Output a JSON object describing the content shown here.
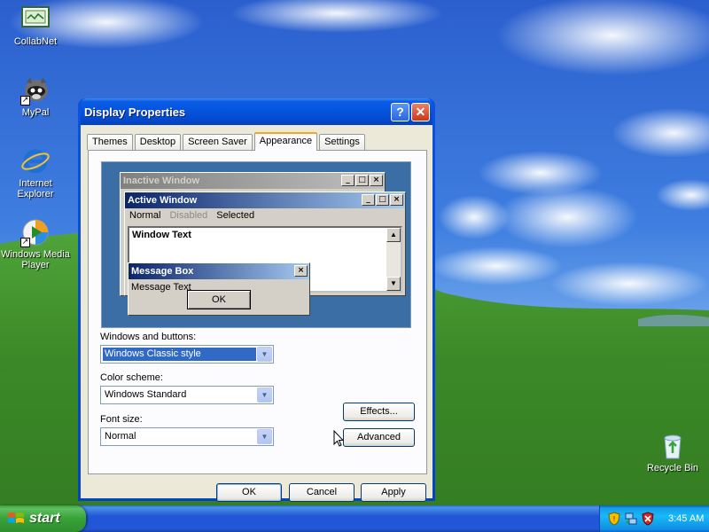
{
  "desktop": {
    "icons": [
      {
        "label": "CollabNet",
        "icon": "collabnet-icon"
      },
      {
        "label": "MyPal",
        "icon": "mypal-icon"
      },
      {
        "label": "Internet Explorer",
        "icon": "internet-explorer-icon"
      },
      {
        "label": "Windows Media Player",
        "icon": "media-player-icon"
      },
      {
        "label": "Recycle Bin",
        "icon": "recycle-bin-icon"
      }
    ]
  },
  "dialog": {
    "title": "Display Properties",
    "help_label": "?",
    "close_label": "✕",
    "tabs": [
      "Themes",
      "Desktop",
      "Screen Saver",
      "Appearance",
      "Settings"
    ],
    "active_tab": "Appearance",
    "preview": {
      "inactive_title": "Inactive Window",
      "active_title": "Active Window",
      "menu": {
        "normal": "Normal",
        "disabled": "Disabled",
        "selected": "Selected"
      },
      "window_text": "Window Text",
      "message_title": "Message Box",
      "message_text": "Message Text",
      "ok_label": "OK"
    },
    "windows_buttons": {
      "label": "Windows and buttons:",
      "value": "Windows Classic style"
    },
    "color_scheme": {
      "label": "Color scheme:",
      "value": "Windows Standard"
    },
    "font_size": {
      "label": "Font size:",
      "value": "Normal"
    },
    "effects_label": "Effects...",
    "advanced_label": "Advanced",
    "ok_label": "OK",
    "cancel_label": "Cancel",
    "apply_label": "Apply"
  },
  "taskbar": {
    "start_label": "start",
    "clock": "3:45 AM"
  },
  "colors": {
    "title_blue": "#0450d8",
    "start_green": "#37a237",
    "tray_blue": "#18b9f7",
    "preview_bg": "#3a6ea5",
    "selection": "#316ac5"
  }
}
